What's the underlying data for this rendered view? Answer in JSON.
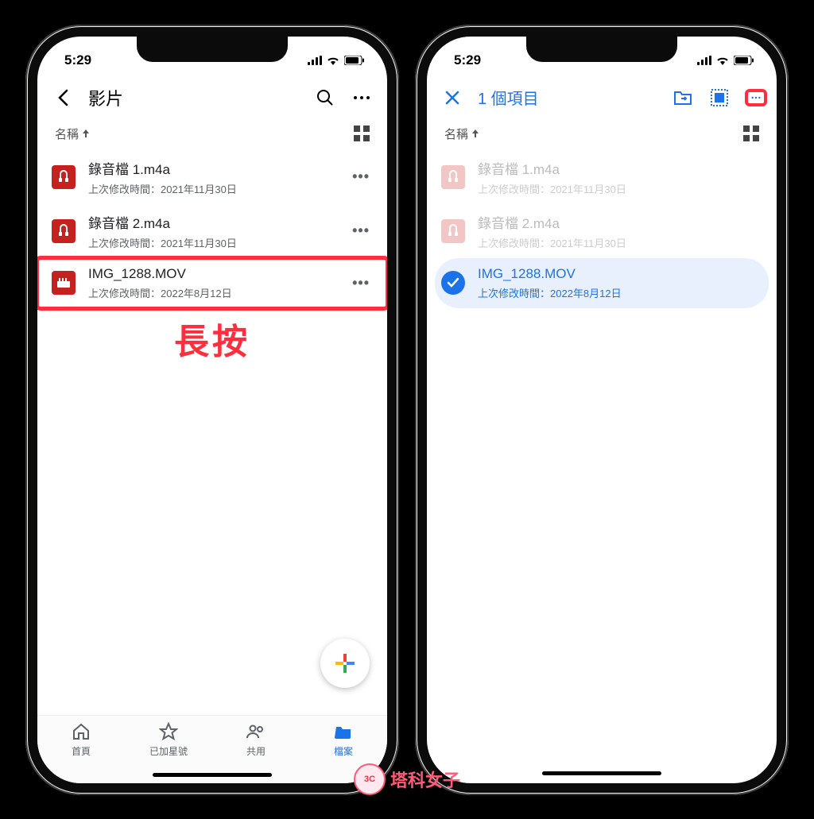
{
  "status": {
    "time": "5:29"
  },
  "left": {
    "header": {
      "title": "影片"
    },
    "sort": {
      "label": "名稱"
    },
    "files": [
      {
        "name": "錄音檔 1.m4a",
        "sub": "上次修改時間：2021年11月30日"
      },
      {
        "name": "錄音檔 2.m4a",
        "sub": "上次修改時間：2021年11月30日"
      },
      {
        "name": "IMG_1288.MOV",
        "sub": "上次修改時間：2022年8月12日"
      }
    ],
    "annotation": "長按",
    "nav": {
      "home": "首頁",
      "starred": "已加星號",
      "shared": "共用",
      "files": "檔案"
    }
  },
  "right": {
    "header": {
      "title": "1 個項目"
    },
    "sort": {
      "label": "名稱"
    },
    "files": [
      {
        "name": "錄音檔 1.m4a",
        "sub": "上次修改時間：2021年11月30日"
      },
      {
        "name": "錄音檔 2.m4a",
        "sub": "上次修改時間：2021年11月30日"
      },
      {
        "name": "IMG_1288.MOV",
        "sub": "上次修改時間：2022年8月12日"
      }
    ]
  },
  "watermark": {
    "text": "塔科女子",
    "badge": "3C"
  }
}
